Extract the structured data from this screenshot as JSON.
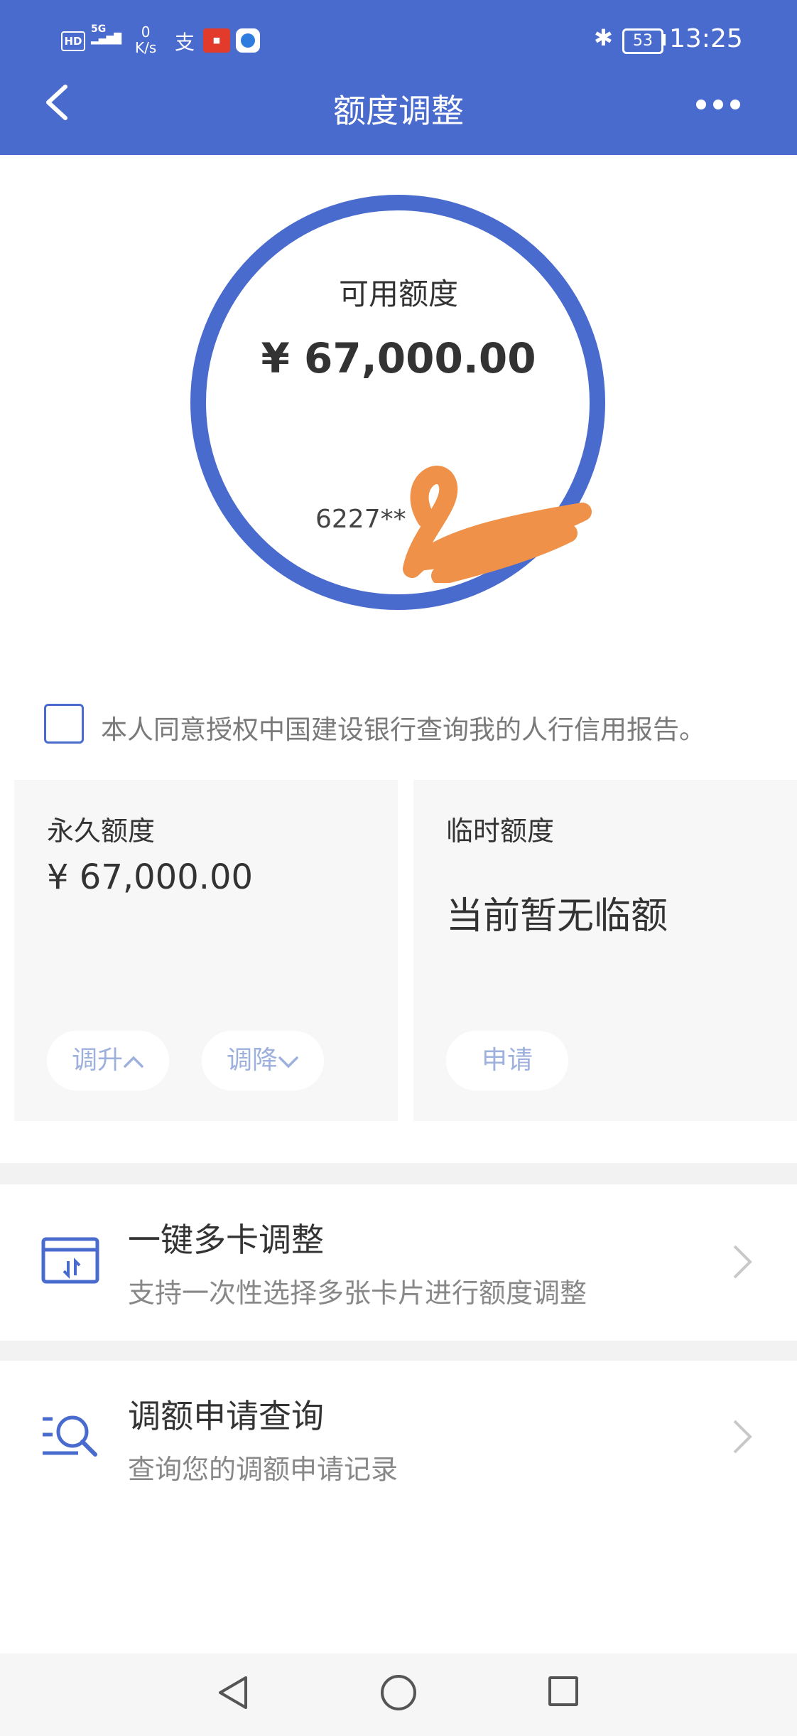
{
  "status_bar": {
    "hd": "HD",
    "network_rate": "0",
    "network_unit": "K/s",
    "battery": "53",
    "time": "13:25"
  },
  "header": {
    "title": "额度调整",
    "back_icon": "chevron-left-icon",
    "more_icon": "more-dots-icon"
  },
  "limit_circle": {
    "label": "可用额度",
    "amount": "¥ 67,000.00",
    "card_masked": "6227**"
  },
  "consent": {
    "text": "本人同意授权中国建设银行查询我的人行信用报告。",
    "checked": false
  },
  "permanent": {
    "label": "永久额度",
    "amount": "¥ 67,000.00",
    "raise_label": "调升",
    "lower_label": "调降"
  },
  "temporary": {
    "label": "临时额度",
    "status": "当前暂无临额",
    "apply_label": "申请"
  },
  "rows": [
    {
      "title": "一键多卡调整",
      "subtitle": "支持一次性选择多张卡片进行额度调整",
      "icon": "card-adjust-icon"
    },
    {
      "title": "调额申请查询",
      "subtitle": "查询您的调额申请记录",
      "icon": "search-list-icon"
    }
  ],
  "colors": {
    "primary": "#4a6bce",
    "redaction": "#f0914a",
    "pill_text": "#9eb0dc"
  }
}
